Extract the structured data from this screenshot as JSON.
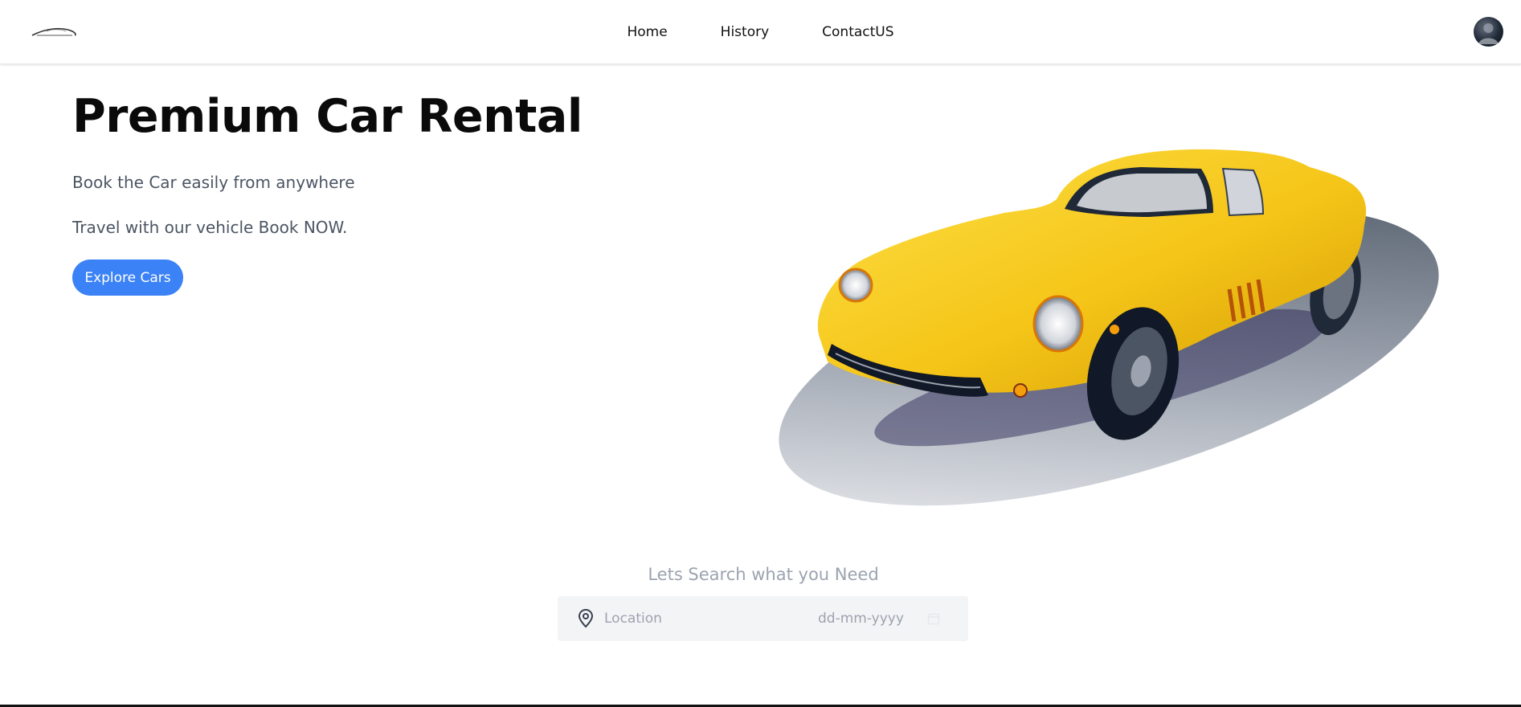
{
  "nav": {
    "logo_icon": "sports-car-logo-icon",
    "links": [
      {
        "label": "Home"
      },
      {
        "label": "History"
      },
      {
        "label": "ContactUS"
      }
    ],
    "avatar_icon": "user-avatar"
  },
  "hero": {
    "title": "Premium Car Rental",
    "line1": "Book the Car easily from anywhere",
    "line2": "Travel with our vehicle Book NOW.",
    "cta_label": "Explore Cars",
    "cta_color": "#3b82f6",
    "car_color": "#f5c518"
  },
  "search": {
    "heading": "Lets Search what you Need",
    "location_placeholder": "Location",
    "date_placeholder": "dd-mm-yyyy",
    "location_icon": "map-pin-icon",
    "date_icon": "calendar-icon"
  }
}
